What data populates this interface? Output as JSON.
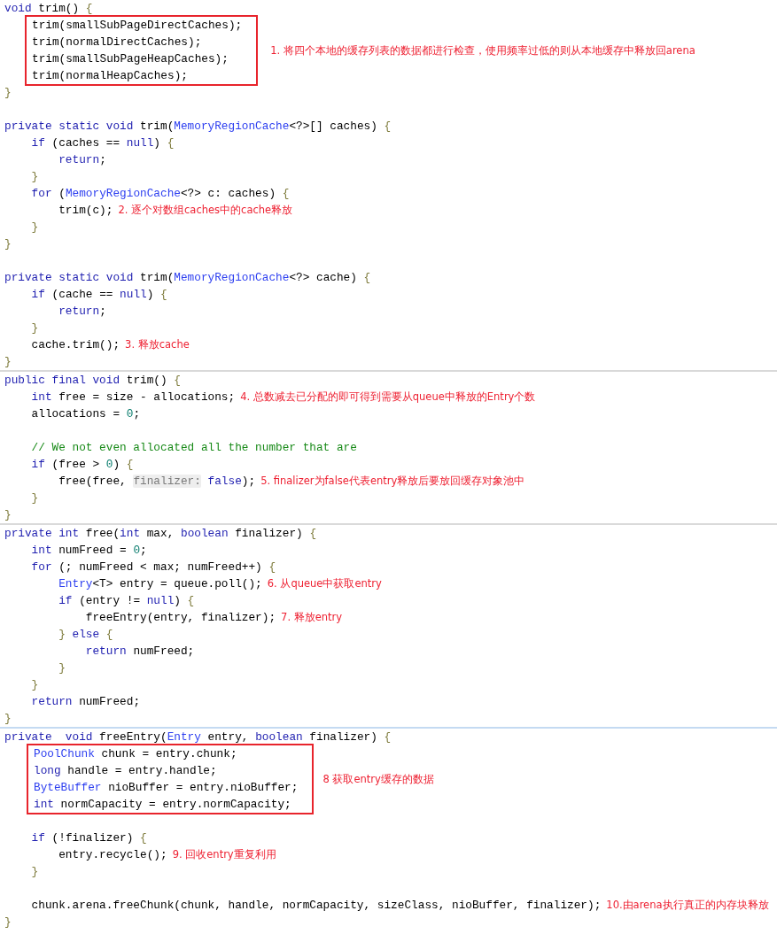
{
  "panels": [
    {
      "blocks": [
        {
          "kind": "line",
          "tokens": [
            {
              "kind": "kw",
              "text": "void"
            },
            {
              "kind": "plain",
              "text": " trim() "
            },
            {
              "kind": "brace",
              "text": "{"
            }
          ]
        },
        {
          "kind": "box",
          "note": "1. 将四个本地的缓存列表的数据都进行检查，使用频率过低的则从本地缓存中释放回arena",
          "lines": [
            {
              "tokens": [
                {
                  "kind": "plain",
                  "text": "trim(smallSubPageDirectCaches);"
                }
              ]
            },
            {
              "tokens": [
                {
                  "kind": "plain",
                  "text": "trim(normalDirectCaches);"
                }
              ]
            },
            {
              "tokens": [
                {
                  "kind": "plain",
                  "text": "trim(smallSubPageHeapCaches);"
                }
              ]
            },
            {
              "tokens": [
                {
                  "kind": "plain",
                  "text": "trim(normalHeapCaches);"
                }
              ]
            }
          ]
        },
        {
          "kind": "line",
          "tokens": [
            {
              "kind": "brace",
              "text": "}"
            }
          ]
        },
        {
          "kind": "blank"
        },
        {
          "kind": "line",
          "tokens": [
            {
              "kind": "kw",
              "text": "private static void"
            },
            {
              "kind": "plain",
              "text": " trim("
            },
            {
              "kind": "type",
              "text": "MemoryRegionCache"
            },
            {
              "kind": "plain",
              "text": "<?>[] caches) "
            },
            {
              "kind": "brace",
              "text": "{"
            }
          ]
        },
        {
          "kind": "line",
          "tokens": [
            {
              "kind": "kw",
              "text": "    if"
            },
            {
              "kind": "plain",
              "text": " (caches == "
            },
            {
              "kind": "kw",
              "text": "null"
            },
            {
              "kind": "plain",
              "text": ") "
            },
            {
              "kind": "brace",
              "text": "{"
            }
          ]
        },
        {
          "kind": "line",
          "tokens": [
            {
              "kind": "kw",
              "text": "        return"
            },
            {
              "kind": "plain",
              "text": ";"
            }
          ]
        },
        {
          "kind": "line",
          "tokens": [
            {
              "kind": "brace",
              "text": "    }"
            }
          ]
        },
        {
          "kind": "line",
          "tokens": [
            {
              "kind": "kw",
              "text": "    for"
            },
            {
              "kind": "plain",
              "text": " ("
            },
            {
              "kind": "type",
              "text": "MemoryRegionCache"
            },
            {
              "kind": "plain",
              "text": "<?> c: caches) "
            },
            {
              "kind": "brace",
              "text": "{"
            }
          ]
        },
        {
          "kind": "line",
          "tokens": [
            {
              "kind": "plain",
              "text": "        trim(c);"
            }
          ],
          "note": "2. 逐个对数组caches中的cache释放"
        },
        {
          "kind": "line",
          "tokens": [
            {
              "kind": "brace",
              "text": "    }"
            }
          ]
        },
        {
          "kind": "line",
          "tokens": [
            {
              "kind": "brace",
              "text": "}"
            }
          ]
        },
        {
          "kind": "blank"
        },
        {
          "kind": "line",
          "tokens": [
            {
              "kind": "kw",
              "text": "private static void"
            },
            {
              "kind": "plain",
              "text": " trim("
            },
            {
              "kind": "type",
              "text": "MemoryRegionCache"
            },
            {
              "kind": "plain",
              "text": "<?> cache) "
            },
            {
              "kind": "brace",
              "text": "{"
            }
          ]
        },
        {
          "kind": "line",
          "tokens": [
            {
              "kind": "kw",
              "text": "    if"
            },
            {
              "kind": "plain",
              "text": " (cache == "
            },
            {
              "kind": "kw",
              "text": "null"
            },
            {
              "kind": "plain",
              "text": ") "
            },
            {
              "kind": "brace",
              "text": "{"
            }
          ]
        },
        {
          "kind": "line",
          "tokens": [
            {
              "kind": "kw",
              "text": "        return"
            },
            {
              "kind": "plain",
              "text": ";"
            }
          ]
        },
        {
          "kind": "line",
          "tokens": [
            {
              "kind": "brace",
              "text": "    }"
            }
          ]
        },
        {
          "kind": "line",
          "tokens": [
            {
              "kind": "plain",
              "text": "    cache.trim();"
            }
          ],
          "note": "3. 释放cache"
        },
        {
          "kind": "line",
          "tokens": [
            {
              "kind": "brace",
              "text": "}"
            }
          ]
        }
      ]
    },
    {
      "blocks": [
        {
          "kind": "line",
          "tokens": [
            {
              "kind": "kw",
              "text": "public final void"
            },
            {
              "kind": "plain",
              "text": " trim() "
            },
            {
              "kind": "brace",
              "text": "{"
            }
          ]
        },
        {
          "kind": "line",
          "tokens": [
            {
              "kind": "kw",
              "text": "    int"
            },
            {
              "kind": "plain",
              "text": " free = size - allocations;"
            }
          ],
          "note": "4. 总数减去已分配的即可得到需要从queue中释放的Entry个数"
        },
        {
          "kind": "line",
          "tokens": [
            {
              "kind": "plain",
              "text": "    allocations = "
            },
            {
              "kind": "num",
              "text": "0"
            },
            {
              "kind": "plain",
              "text": ";"
            }
          ]
        },
        {
          "kind": "blank"
        },
        {
          "kind": "line",
          "tokens": [
            {
              "kind": "comment",
              "text": "    // We not even allocated all the number that are"
            }
          ]
        },
        {
          "kind": "line",
          "tokens": [
            {
              "kind": "kw",
              "text": "    if"
            },
            {
              "kind": "plain",
              "text": " (free > "
            },
            {
              "kind": "num",
              "text": "0"
            },
            {
              "kind": "plain",
              "text": ") "
            },
            {
              "kind": "brace",
              "text": "{"
            }
          ]
        },
        {
          "kind": "line",
          "tokens": [
            {
              "kind": "plain",
              "text": "        free(free, "
            },
            {
              "kind": "hint",
              "text": "finalizer:"
            },
            {
              "kind": "kw",
              "text": " false"
            },
            {
              "kind": "plain",
              "text": ");"
            }
          ],
          "note": "5. finalizer为false代表entry释放后要放回缓存对象池中"
        },
        {
          "kind": "line",
          "tokens": [
            {
              "kind": "brace",
              "text": "    }"
            }
          ]
        },
        {
          "kind": "line",
          "tokens": [
            {
              "kind": "brace",
              "text": "}"
            }
          ]
        }
      ]
    },
    {
      "blocks": [
        {
          "kind": "line",
          "tokens": [
            {
              "kind": "kw",
              "text": "private int"
            },
            {
              "kind": "plain",
              "text": " free("
            },
            {
              "kind": "kw",
              "text": "int"
            },
            {
              "kind": "plain",
              "text": " max, "
            },
            {
              "kind": "kw",
              "text": "boolean"
            },
            {
              "kind": "plain",
              "text": " finalizer) "
            },
            {
              "kind": "brace",
              "text": "{"
            }
          ]
        },
        {
          "kind": "line",
          "tokens": [
            {
              "kind": "kw",
              "text": "    int"
            },
            {
              "kind": "plain",
              "text": " numFreed = "
            },
            {
              "kind": "num",
              "text": "0"
            },
            {
              "kind": "plain",
              "text": ";"
            }
          ]
        },
        {
          "kind": "line",
          "tokens": [
            {
              "kind": "kw",
              "text": "    for"
            },
            {
              "kind": "plain",
              "text": " (; numFreed < max; numFreed++) "
            },
            {
              "kind": "brace",
              "text": "{"
            }
          ]
        },
        {
          "kind": "line",
          "tokens": [
            {
              "kind": "type",
              "text": "        Entry"
            },
            {
              "kind": "plain",
              "text": "<T> entry = queue.poll();"
            }
          ],
          "note": "6. 从queue中获取entry"
        },
        {
          "kind": "line",
          "tokens": [
            {
              "kind": "kw",
              "text": "        if"
            },
            {
              "kind": "plain",
              "text": " (entry != "
            },
            {
              "kind": "kw",
              "text": "null"
            },
            {
              "kind": "plain",
              "text": ") "
            },
            {
              "kind": "brace",
              "text": "{"
            }
          ]
        },
        {
          "kind": "line",
          "tokens": [
            {
              "kind": "plain",
              "text": "            freeEntry(entry, finalizer);"
            }
          ],
          "note": "7. 释放entry"
        },
        {
          "kind": "line",
          "tokens": [
            {
              "kind": "brace",
              "text": "        }"
            },
            {
              "kind": "kw",
              "text": " else"
            },
            {
              "kind": "brace",
              "text": " {"
            }
          ]
        },
        {
          "kind": "line",
          "tokens": [
            {
              "kind": "kw",
              "text": "            return"
            },
            {
              "kind": "plain",
              "text": " numFreed;"
            }
          ]
        },
        {
          "kind": "line",
          "tokens": [
            {
              "kind": "brace",
              "text": "        }"
            }
          ]
        },
        {
          "kind": "line",
          "tokens": [
            {
              "kind": "brace",
              "text": "    }"
            }
          ]
        },
        {
          "kind": "line",
          "tokens": [
            {
              "kind": "kw",
              "text": "    return"
            },
            {
              "kind": "plain",
              "text": " numFreed;"
            }
          ]
        },
        {
          "kind": "line",
          "tokens": [
            {
              "kind": "brace",
              "text": "}"
            }
          ]
        }
      ]
    },
    {
      "blocks": [
        {
          "kind": "line",
          "tokens": [
            {
              "kind": "kw",
              "text": "private  void"
            },
            {
              "kind": "plain",
              "text": " freeEntry("
            },
            {
              "kind": "type",
              "text": "Entry"
            },
            {
              "kind": "plain",
              "text": " entry, "
            },
            {
              "kind": "kw",
              "text": "boolean"
            },
            {
              "kind": "plain",
              "text": " finalizer) "
            },
            {
              "kind": "brace",
              "text": "{"
            }
          ]
        },
        {
          "kind": "box",
          "note": "8 获取entry缓存的数据",
          "lines": [
            {
              "tokens": [
                {
                  "kind": "type",
                  "text": "PoolChunk"
                },
                {
                  "kind": "plain",
                  "text": " chunk = entry.chunk;"
                }
              ]
            },
            {
              "tokens": [
                {
                  "kind": "kw",
                  "text": "long"
                },
                {
                  "kind": "plain",
                  "text": " handle = entry.handle;"
                }
              ]
            },
            {
              "tokens": [
                {
                  "kind": "type",
                  "text": "ByteBuffer"
                },
                {
                  "kind": "plain",
                  "text": " nioBuffer = entry.nioBuffer;"
                }
              ]
            },
            {
              "tokens": [
                {
                  "kind": "kw",
                  "text": "int"
                },
                {
                  "kind": "plain",
                  "text": " normCapacity = entry.normCapacity;"
                }
              ]
            }
          ]
        },
        {
          "kind": "blank"
        },
        {
          "kind": "line",
          "tokens": [
            {
              "kind": "kw",
              "text": "    if"
            },
            {
              "kind": "plain",
              "text": " (!finalizer) "
            },
            {
              "kind": "brace",
              "text": "{"
            }
          ]
        },
        {
          "kind": "line",
          "tokens": [
            {
              "kind": "plain",
              "text": "        entry.recycle();"
            }
          ],
          "note": "9. 回收entry重复利用"
        },
        {
          "kind": "line",
          "tokens": [
            {
              "kind": "brace",
              "text": "    }"
            }
          ]
        },
        {
          "kind": "blank"
        },
        {
          "kind": "line",
          "tokens": [
            {
              "kind": "plain",
              "text": "    chunk.arena.freeChunk(chunk, handle, normCapacity, sizeClass, nioBuffer, finalizer);"
            }
          ],
          "note": "10.由arena执行真正的内存块释放"
        },
        {
          "kind": "line",
          "tokens": [
            {
              "kind": "brace",
              "text": "}"
            }
          ]
        }
      ]
    }
  ]
}
